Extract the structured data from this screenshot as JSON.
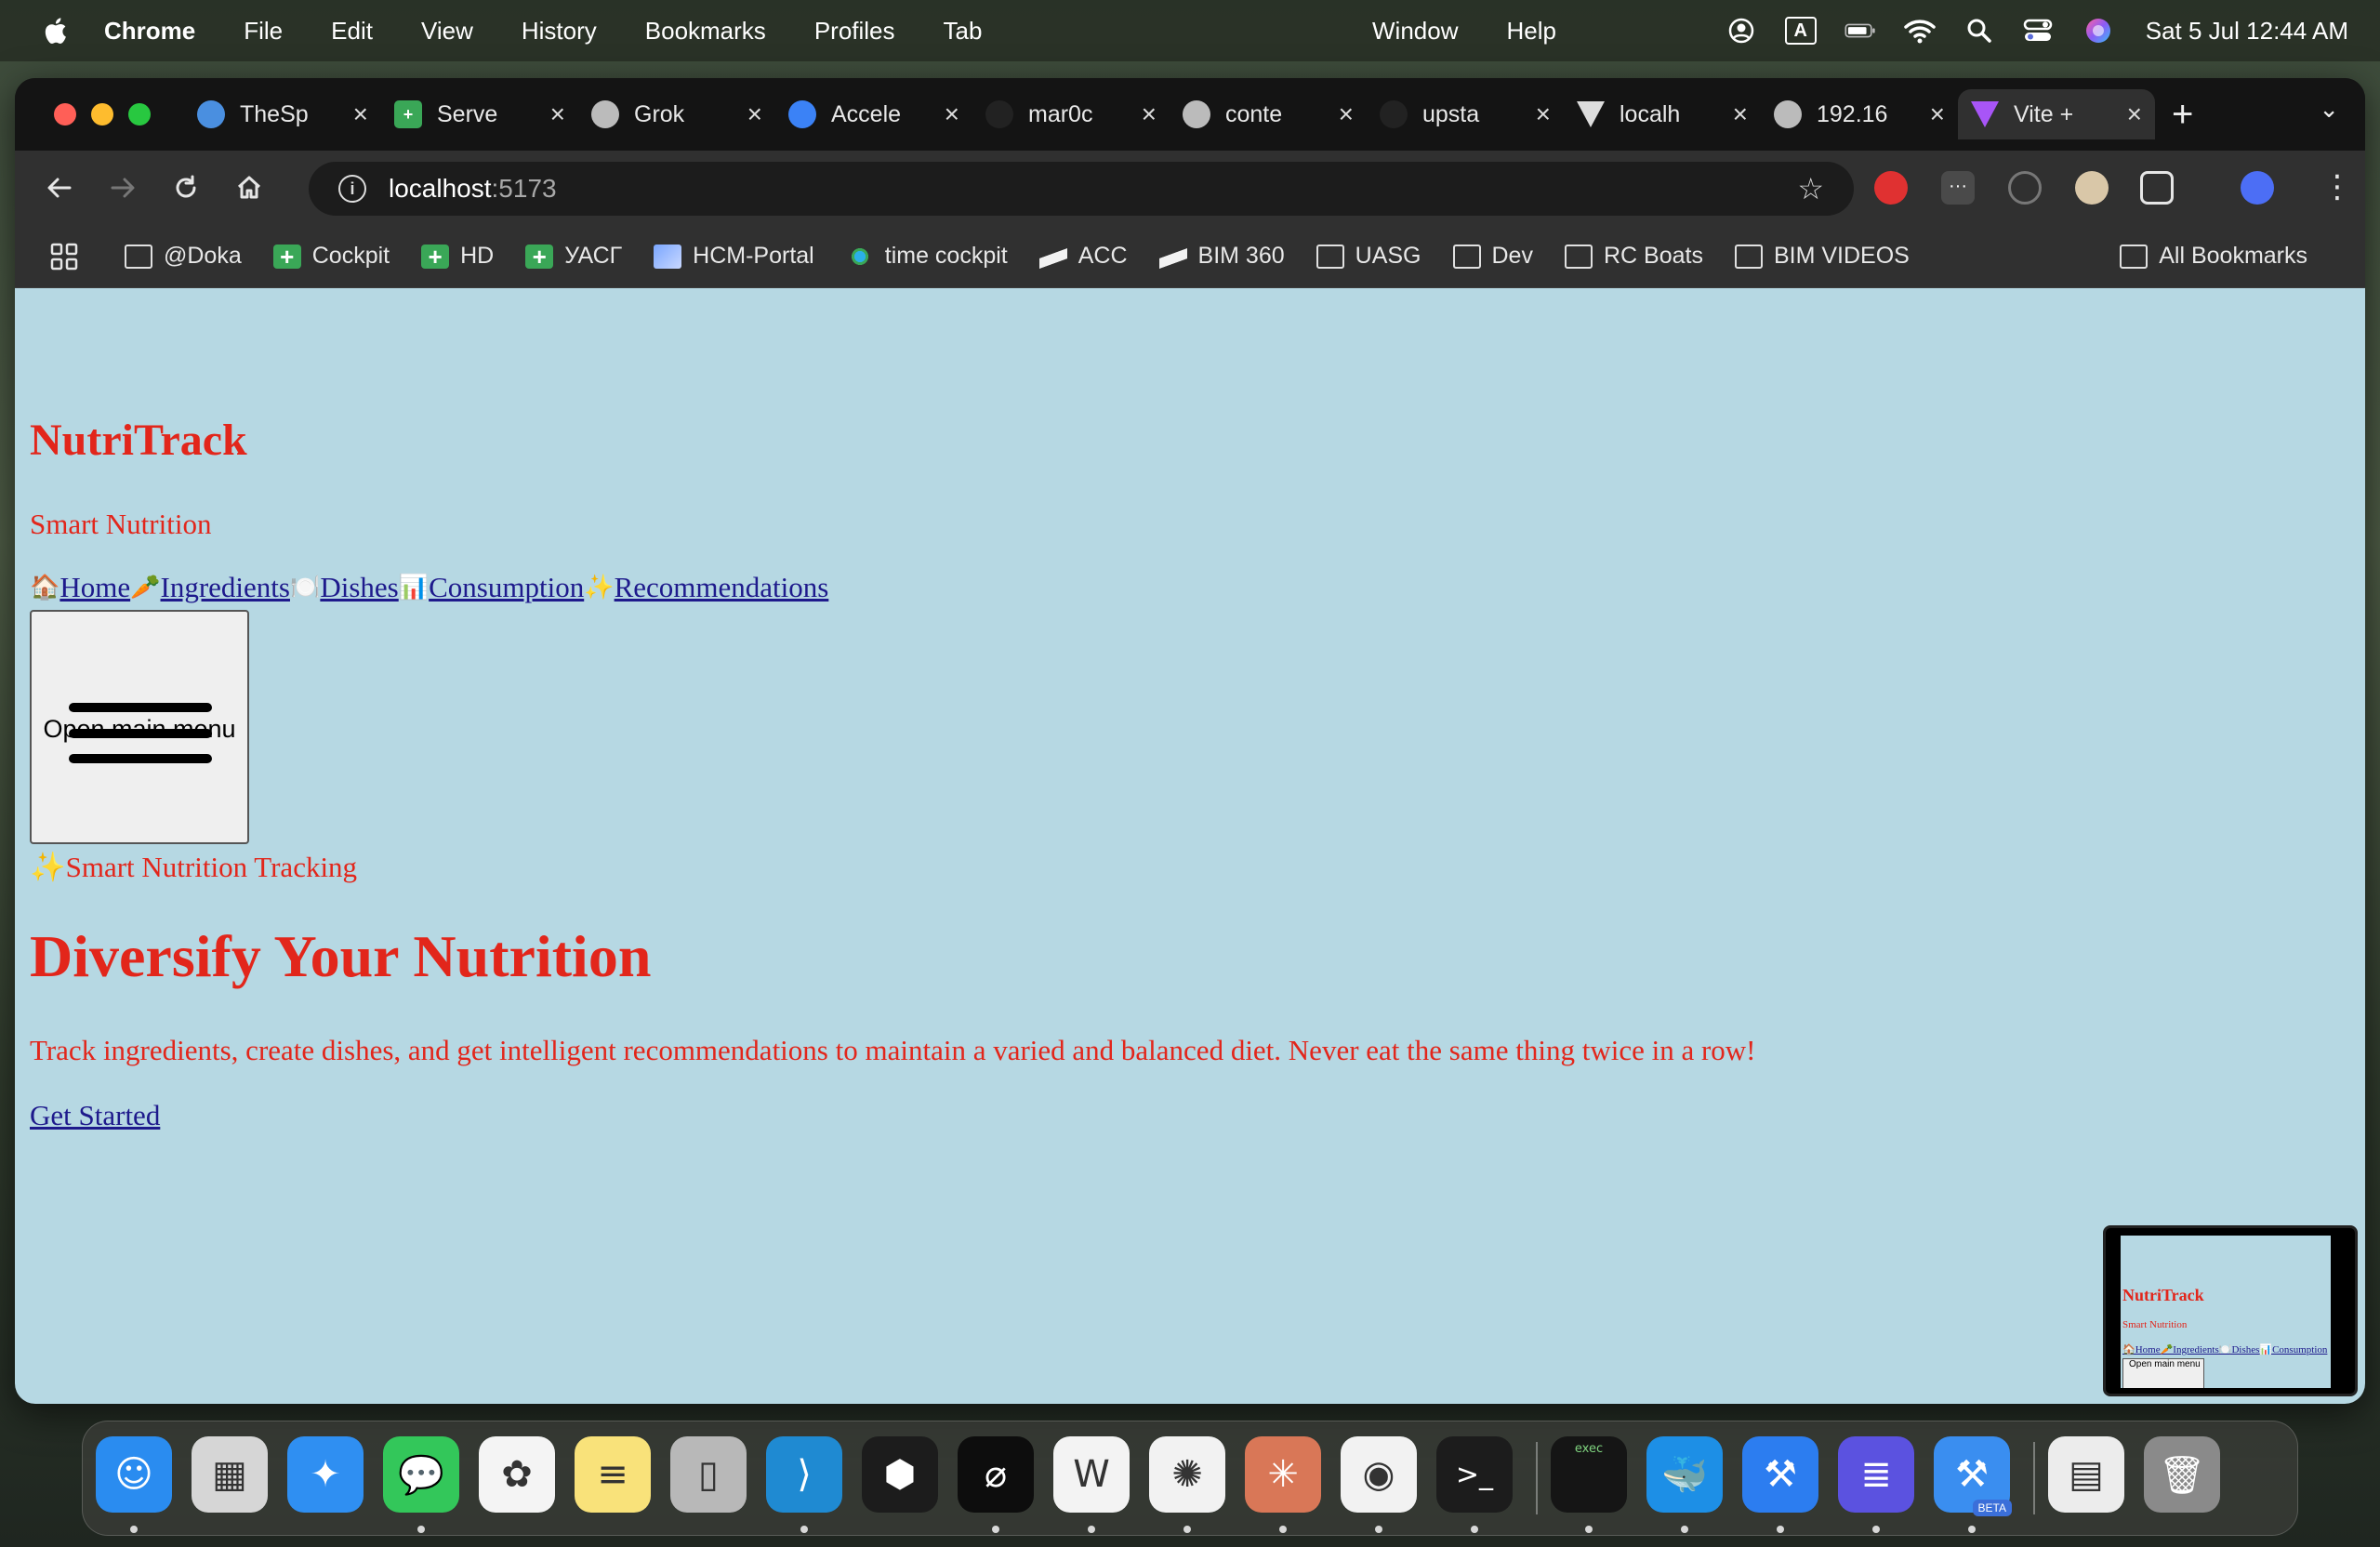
{
  "menubar": {
    "app": "Chrome",
    "items": [
      "File",
      "Edit",
      "View",
      "History",
      "Bookmarks",
      "Profiles",
      "Tab"
    ],
    "right_items": [
      "Window",
      "Help"
    ],
    "status_icons": [
      "user-circle-icon",
      "input-source-icon",
      "battery-icon",
      "wifi-icon",
      "search-icon",
      "control-center-icon",
      "siri-icon"
    ],
    "input_source": "A",
    "clock": "Sat 5 Jul  12:44 AM"
  },
  "tabs": [
    {
      "label": "TheSp",
      "icon": "globe-icon",
      "color": "#4a8fe0"
    },
    {
      "label": "Serve",
      "icon": "green-plus-icon",
      "color": "#3aa757"
    },
    {
      "label": "Grok",
      "icon": "globe-icon",
      "color": "#bbbbbb"
    },
    {
      "label": "Accele",
      "icon": "accelerator-icon",
      "color": "#3b82f6"
    },
    {
      "label": "mar0c",
      "icon": "github-icon",
      "color": "#222222"
    },
    {
      "label": "conte",
      "icon": "globe-icon",
      "color": "#bbbbbb"
    },
    {
      "label": "upsta",
      "icon": "github-icon",
      "color": "#222222"
    },
    {
      "label": "localh",
      "icon": "vite-icon",
      "color": "#dddddd"
    },
    {
      "label": "192.16",
      "icon": "globe-icon",
      "color": "#bbbbbb"
    },
    {
      "label": "Vite +",
      "icon": "vite-icon",
      "color": "#a855f7",
      "active": true
    }
  ],
  "address": {
    "host": "localhost",
    "port": ":5173"
  },
  "bookmarks": [
    {
      "label": "@Doka",
      "icon": "folder-icon"
    },
    {
      "label": "Cockpit",
      "icon": "green-plus-icon"
    },
    {
      "label": "HD",
      "icon": "green-plus-icon"
    },
    {
      "label": "УАСГ",
      "icon": "green-plus-icon"
    },
    {
      "label": "HCM-Portal",
      "icon": "portal-icon"
    },
    {
      "label": "time cockpit",
      "icon": "timecockpit-icon"
    },
    {
      "label": "ACC",
      "icon": "autodesk-icon"
    },
    {
      "label": "BIM 360",
      "icon": "autodesk-icon"
    },
    {
      "label": "UASG",
      "icon": "folder-icon"
    },
    {
      "label": "Dev",
      "icon": "folder-icon"
    },
    {
      "label": "RC Boats",
      "icon": "folder-icon"
    },
    {
      "label": "BIM VIDEOS",
      "icon": "folder-icon"
    }
  ],
  "all_bookmarks": "All Bookmarks",
  "page": {
    "brand": "NutriTrack",
    "tagline": "Smart Nutrition",
    "nav": [
      {
        "emoji": "🏠",
        "label": "Home"
      },
      {
        "emoji": "🥕",
        "label": "Ingredients"
      },
      {
        "emoji": "🍽️",
        "label": "Dishes"
      },
      {
        "emoji": "📊",
        "label": "Consumption"
      },
      {
        "emoji": "✨",
        "label": "Recommendations"
      }
    ],
    "menu_button": "Open main menu",
    "pill_emoji": "✨",
    "pill_text": "Smart Nutrition Tracking",
    "hero_title": "Diversify Your Nutrition",
    "hero_text": "Track ingredients, create dishes, and get intelligent recommendations to maintain a varied and balanced diet. Never eat the same thing twice in a row!",
    "cta": "Get Started",
    "text_color": "#e2261b",
    "link_color": "#1e1a8c",
    "background": "#b6d8e3"
  },
  "pip": {
    "brand": "NutriTrack",
    "tagline": "Smart Nutrition",
    "nav": "🏠Home🥕Ingredients🍽️Dishes📊Consumption",
    "menu_button": "Open main menu"
  },
  "dock": [
    {
      "name": "finder-icon",
      "color": "#2a8cf0",
      "glyph": "☺",
      "running": true
    },
    {
      "name": "launchpad-icon",
      "color": "#d6d6d6",
      "glyph": "▦",
      "running": false
    },
    {
      "name": "safari-icon",
      "color": "#2f8ff2",
      "glyph": "✦",
      "running": false
    },
    {
      "name": "messages-icon",
      "color": "#33c75a",
      "glyph": "💬",
      "running": true
    },
    {
      "name": "photos-icon",
      "color": "#f4f4f4",
      "glyph": "✿",
      "running": false
    },
    {
      "name": "notes-icon",
      "color": "#f9e27a",
      "glyph": "≡",
      "running": false
    },
    {
      "name": "iphone-mirroring-icon",
      "color": "#b8b8b8",
      "glyph": "▯",
      "running": false
    },
    {
      "name": "vscode-icon",
      "color": "#1f8ad2",
      "glyph": "⟩",
      "running": true
    },
    {
      "name": "cube-app-icon",
      "color": "#1c1c1c",
      "glyph": "⬢",
      "running": false
    },
    {
      "name": "perplexity-icon",
      "color": "#0d0d0d",
      "glyph": "⌀",
      "running": true
    },
    {
      "name": "warp-icon",
      "color": "#f3f3f3",
      "glyph": "W",
      "running": true
    },
    {
      "name": "chatgpt-icon",
      "color": "#f2f2f2",
      "glyph": "✺",
      "running": true
    },
    {
      "name": "claude-icon",
      "color": "#d97757",
      "glyph": "✳",
      "running": true
    },
    {
      "name": "chrome-icon",
      "color": "#f2f2f2",
      "glyph": "◉",
      "running": true
    },
    {
      "name": "terminal-icon",
      "color": "#1c1c1c",
      "glyph": ">_",
      "running": true
    },
    {
      "name": "exec-icon",
      "color": "#151515",
      "glyph": "exec",
      "running": true
    },
    {
      "name": "docker-icon",
      "color": "#1d8fe6",
      "glyph": "🐳",
      "running": true
    },
    {
      "name": "xcode-icon",
      "color": "#2c7df0",
      "glyph": "⚒",
      "running": true
    },
    {
      "name": "linear-icon",
      "color": "#5b52e0",
      "glyph": "≣",
      "running": true
    },
    {
      "name": "xcode-beta-icon",
      "color": "#3a8ef0",
      "glyph": "⚒",
      "running": true
    },
    {
      "name": "archive-utility-icon",
      "color": "#ececec",
      "glyph": "▤",
      "running": false
    },
    {
      "name": "trash-icon",
      "color": "#8a8a8a",
      "glyph": "🗑",
      "running": false
    }
  ],
  "dock_beta_label": "BETA"
}
